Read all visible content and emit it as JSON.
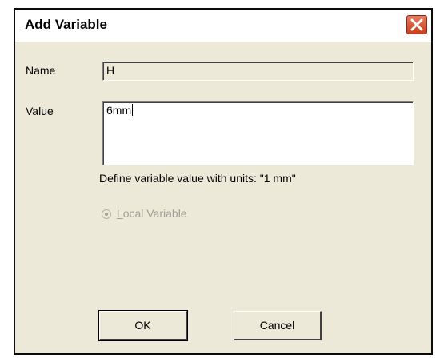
{
  "dialog": {
    "title": "Add Variable",
    "name_label": "Name",
    "name_value": "H",
    "value_label": "Value",
    "value_text": "6mm",
    "hint": "Define variable value with units: \"1 mm\"",
    "radio_first_letter": "L",
    "radio_rest": "ocal Variable",
    "ok_label": "OK",
    "cancel_label": "Cancel"
  },
  "icons": {
    "close": "close-icon"
  },
  "colors": {
    "dialog_bg": "#ece9d8",
    "close_red": "#d35a35",
    "disabled_text": "#a09f94"
  }
}
